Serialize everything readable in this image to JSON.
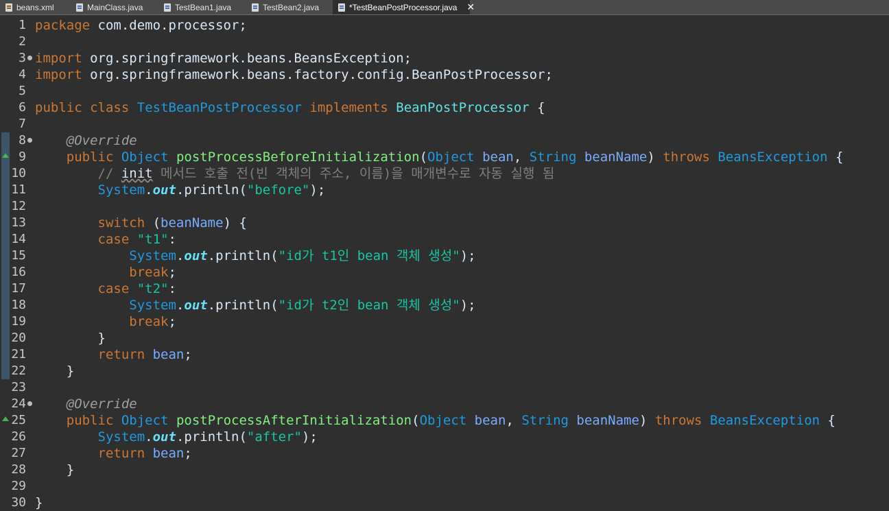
{
  "tabs": [
    {
      "label": "beans.xml",
      "icon": "xml-file-icon"
    },
    {
      "label": "MainClass.java",
      "icon": "java-file-icon"
    },
    {
      "label": "TestBean1.java",
      "icon": "java-file-icon"
    },
    {
      "label": "TestBean2.java",
      "icon": "java-file-icon"
    },
    {
      "label": "*TestBeanPostProcessor.java",
      "icon": "java-file-icon",
      "active": true
    }
  ],
  "close_glyph": "✕",
  "lines": [
    {
      "n": "1",
      "tokens": [
        [
          "kw",
          "package"
        ],
        [
          "pl",
          " com.demo.processor;"
        ]
      ]
    },
    {
      "n": "2",
      "tokens": []
    },
    {
      "n": "3",
      "fold": true,
      "tokens": [
        [
          "kw",
          "import"
        ],
        [
          "pl",
          " org.springframework.beans.BeansException;"
        ]
      ]
    },
    {
      "n": "4",
      "tokens": [
        [
          "kw",
          "import"
        ],
        [
          "pl",
          " org.springframework.beans.factory.config.BeanPostProcessor;"
        ]
      ]
    },
    {
      "n": "5",
      "tokens": []
    },
    {
      "n": "6",
      "tokens": [
        [
          "kw",
          "public"
        ],
        [
          "pl",
          " "
        ],
        [
          "kw",
          "class"
        ],
        [
          "pl",
          " "
        ],
        [
          "cls",
          "TestBeanPostProcessor"
        ],
        [
          "pl",
          " "
        ],
        [
          "kw",
          "implements"
        ],
        [
          "pl",
          " "
        ],
        [
          "impl",
          "BeanPostProcessor"
        ],
        [
          "pl",
          " {"
        ]
      ]
    },
    {
      "n": "7",
      "tokens": []
    },
    {
      "n": "8",
      "fold": true,
      "bar": true,
      "tokens": [
        [
          "pl",
          "    "
        ],
        [
          "an",
          "@Override"
        ]
      ]
    },
    {
      "n": "9",
      "bar": true,
      "marker": true,
      "tokens": [
        [
          "pl",
          "    "
        ],
        [
          "kw",
          "public"
        ],
        [
          "pl",
          " "
        ],
        [
          "ty",
          "Object"
        ],
        [
          "pl",
          " "
        ],
        [
          "mt",
          "postProcessBeforeInitialization"
        ],
        [
          "pl",
          "("
        ],
        [
          "ty",
          "Object"
        ],
        [
          "pl",
          " "
        ],
        [
          "pr",
          "bean"
        ],
        [
          "pl",
          ", "
        ],
        [
          "ty",
          "String"
        ],
        [
          "pl",
          " "
        ],
        [
          "pr",
          "beanName"
        ],
        [
          "pl",
          ") "
        ],
        [
          "kw",
          "throws"
        ],
        [
          "pl",
          " "
        ],
        [
          "ty",
          "BeansException"
        ],
        [
          "pl",
          " {"
        ]
      ]
    },
    {
      "n": "10",
      "bar": true,
      "tokens": [
        [
          "pl",
          "        "
        ],
        [
          "cm",
          "// "
        ],
        [
          "sp",
          "init"
        ],
        [
          "cm",
          " 메서드 호출 전(빈 객체의 주소, 이름)을 매개변수로 자동 실행 됨"
        ]
      ]
    },
    {
      "n": "11",
      "bar": true,
      "tokens": [
        [
          "pl",
          "        "
        ],
        [
          "ty",
          "System"
        ],
        [
          "pl",
          "."
        ],
        [
          "sf",
          "out"
        ],
        [
          "pl",
          ".println("
        ],
        [
          "st",
          "\"before\""
        ],
        [
          "pl",
          ");"
        ]
      ]
    },
    {
      "n": "12",
      "bar": true,
      "tokens": []
    },
    {
      "n": "13",
      "bar": true,
      "tokens": [
        [
          "pl",
          "        "
        ],
        [
          "kw",
          "switch"
        ],
        [
          "pl",
          " ("
        ],
        [
          "pr",
          "beanName"
        ],
        [
          "pl",
          ") {"
        ]
      ]
    },
    {
      "n": "14",
      "bar": true,
      "tokens": [
        [
          "pl",
          "        "
        ],
        [
          "kw",
          "case"
        ],
        [
          "pl",
          " "
        ],
        [
          "st",
          "\"t1\""
        ],
        [
          "pl",
          ":"
        ]
      ]
    },
    {
      "n": "15",
      "bar": true,
      "tokens": [
        [
          "pl",
          "            "
        ],
        [
          "ty",
          "System"
        ],
        [
          "pl",
          "."
        ],
        [
          "sf",
          "out"
        ],
        [
          "pl",
          ".println("
        ],
        [
          "st",
          "\"id가 t1인 bean 객체 생성\""
        ],
        [
          "pl",
          ");"
        ]
      ]
    },
    {
      "n": "16",
      "bar": true,
      "tokens": [
        [
          "pl",
          "            "
        ],
        [
          "kw",
          "break"
        ],
        [
          "pl",
          ";"
        ]
      ]
    },
    {
      "n": "17",
      "bar": true,
      "tokens": [
        [
          "pl",
          "        "
        ],
        [
          "kw",
          "case"
        ],
        [
          "pl",
          " "
        ],
        [
          "st",
          "\"t2\""
        ],
        [
          "pl",
          ":"
        ]
      ]
    },
    {
      "n": "18",
      "bar": true,
      "tokens": [
        [
          "pl",
          "            "
        ],
        [
          "ty",
          "System"
        ],
        [
          "pl",
          "."
        ],
        [
          "sf",
          "out"
        ],
        [
          "pl",
          ".println("
        ],
        [
          "st",
          "\"id가 t2인 bean 객체 생성\""
        ],
        [
          "pl",
          ");"
        ]
      ]
    },
    {
      "n": "19",
      "bar": true,
      "tokens": [
        [
          "pl",
          "            "
        ],
        [
          "kw",
          "break"
        ],
        [
          "pl",
          ";"
        ]
      ]
    },
    {
      "n": "20",
      "bar": true,
      "tokens": [
        [
          "pl",
          "        }"
        ]
      ]
    },
    {
      "n": "21",
      "bar": true,
      "tokens": [
        [
          "pl",
          "        "
        ],
        [
          "kw",
          "return"
        ],
        [
          "pl",
          " "
        ],
        [
          "pr",
          "bean"
        ],
        [
          "pl",
          ";"
        ]
      ]
    },
    {
      "n": "22",
      "bar": true,
      "tokens": [
        [
          "pl",
          "    }"
        ]
      ]
    },
    {
      "n": "23",
      "tokens": []
    },
    {
      "n": "24",
      "fold": true,
      "tokens": [
        [
          "pl",
          "    "
        ],
        [
          "an",
          "@Override"
        ]
      ]
    },
    {
      "n": "25",
      "marker": true,
      "tokens": [
        [
          "pl",
          "    "
        ],
        [
          "kw",
          "public"
        ],
        [
          "pl",
          " "
        ],
        [
          "ty",
          "Object"
        ],
        [
          "pl",
          " "
        ],
        [
          "mt",
          "postProcessAfterInitialization"
        ],
        [
          "pl",
          "("
        ],
        [
          "ty",
          "Object"
        ],
        [
          "pl",
          " "
        ],
        [
          "pr",
          "bean"
        ],
        [
          "pl",
          ", "
        ],
        [
          "ty",
          "String"
        ],
        [
          "pl",
          " "
        ],
        [
          "pr",
          "beanName"
        ],
        [
          "pl",
          ") "
        ],
        [
          "kw",
          "throws"
        ],
        [
          "pl",
          " "
        ],
        [
          "ty",
          "BeansException"
        ],
        [
          "pl",
          " {"
        ]
      ]
    },
    {
      "n": "26",
      "tokens": [
        [
          "pl",
          "        "
        ],
        [
          "ty",
          "System"
        ],
        [
          "pl",
          "."
        ],
        [
          "sf",
          "out"
        ],
        [
          "pl",
          ".println("
        ],
        [
          "st",
          "\"after\""
        ],
        [
          "pl",
          ");"
        ]
      ]
    },
    {
      "n": "27",
      "tokens": [
        [
          "pl",
          "        "
        ],
        [
          "kw",
          "return"
        ],
        [
          "pl",
          " "
        ],
        [
          "pr",
          "bean"
        ],
        [
          "pl",
          ";"
        ]
      ]
    },
    {
      "n": "28",
      "tokens": [
        [
          "pl",
          "    }"
        ]
      ]
    },
    {
      "n": "29",
      "tokens": []
    },
    {
      "n": "30",
      "tokens": [
        [
          "pl",
          "}"
        ]
      ]
    }
  ]
}
